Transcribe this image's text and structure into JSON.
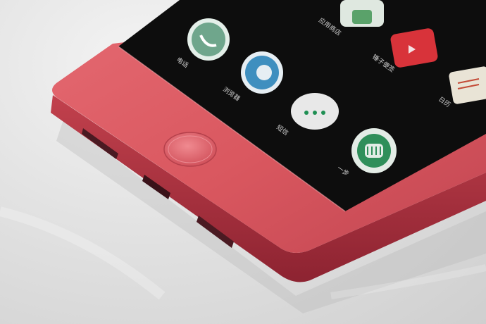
{
  "photo": {
    "subject": "Red smartphone corner with physical home button",
    "device_color": "#d9575f",
    "edge_color": "#b83a47",
    "screen_color": "#0d0d0d"
  },
  "apps": [
    {
      "label": "电话",
      "icon": "phone-icon",
      "color": "#6fa68c"
    },
    {
      "label": "浏览器",
      "icon": "browser-icon",
      "color": "#3f8fbf"
    },
    {
      "label": "短信",
      "icon": "messages-icon",
      "color": "#e8e8e8"
    },
    {
      "label": "一步",
      "icon": "onestep-icon",
      "color": "#2f8f5a"
    },
    {
      "label": "应用商店",
      "icon": "store-icon",
      "color": "#5aa26a"
    },
    {
      "label": "锤子便签",
      "icon": "notes-icon",
      "color": "#d8333a"
    },
    {
      "label": "日历",
      "icon": "calendar-icon",
      "color": "#e9e4d6"
    }
  ]
}
